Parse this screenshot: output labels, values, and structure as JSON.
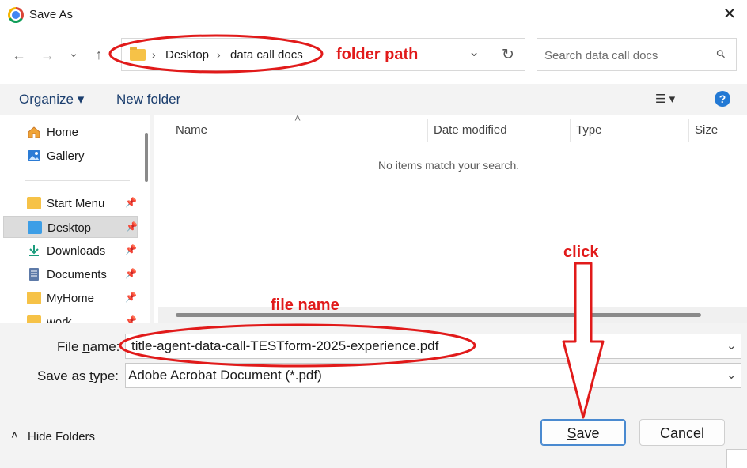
{
  "window": {
    "title": "Save As",
    "close_glyph": "✕"
  },
  "nav": {
    "back_glyph": "←",
    "forward_glyph": "→",
    "recent_glyph": "⌄",
    "up_glyph": "↑"
  },
  "address": {
    "crumbs": [
      "Desktop",
      "data call docs"
    ],
    "sep": "›",
    "dropdown_glyph": "⌄",
    "refresh_glyph": "↻"
  },
  "search": {
    "placeholder": "Search data call docs",
    "icon": "⚲"
  },
  "toolbar": {
    "organize": "Organize ▾",
    "new_folder": "New folder",
    "view_glyph": "☰ ▾",
    "help_glyph": "?"
  },
  "sidebar": {
    "items": [
      {
        "label": "Home",
        "icon": "home-icon"
      },
      {
        "label": "Gallery",
        "icon": "gallery-icon"
      },
      {
        "label": "Start Menu",
        "icon": "folder-icon",
        "pinned": true
      },
      {
        "label": "Desktop",
        "icon": "desktop-icon",
        "pinned": true,
        "selected": true
      },
      {
        "label": "Downloads",
        "icon": "download-icon",
        "pinned": true
      },
      {
        "label": "Documents",
        "icon": "documents-icon",
        "pinned": true
      },
      {
        "label": "MyHome",
        "icon": "folder-icon",
        "pinned": true
      },
      {
        "label": "work",
        "icon": "folder-icon",
        "pinned": true
      }
    ],
    "pin_glyph": "📌"
  },
  "columns": {
    "name": "Name",
    "date": "Date modified",
    "type": "Type",
    "size": "Size",
    "sort_glyph": "˄"
  },
  "empty_message": "No items match your search.",
  "form": {
    "file_name_label_pre": "File ",
    "file_name_label_ul": "n",
    "file_name_label_post": "ame:",
    "file_name_value": "title-agent-data-call-TESTform-2025-experience.pdf",
    "type_label_pre": "Save as ",
    "type_label_ul": "t",
    "type_label_post": "ype:",
    "type_value": "Adobe Acrobat Document (*.pdf)",
    "dd_glyph": "⌄"
  },
  "footer": {
    "hide_folders": "Hide Folders",
    "chevron": "˄"
  },
  "buttons": {
    "save_ul": "S",
    "save_rest": "ave",
    "cancel": "Cancel"
  },
  "annotations": {
    "folder_path": "folder path",
    "file_name": "file name",
    "click": "click"
  },
  "colors": {
    "annotation": "#e11a1a",
    "accent": "#2379d4"
  }
}
